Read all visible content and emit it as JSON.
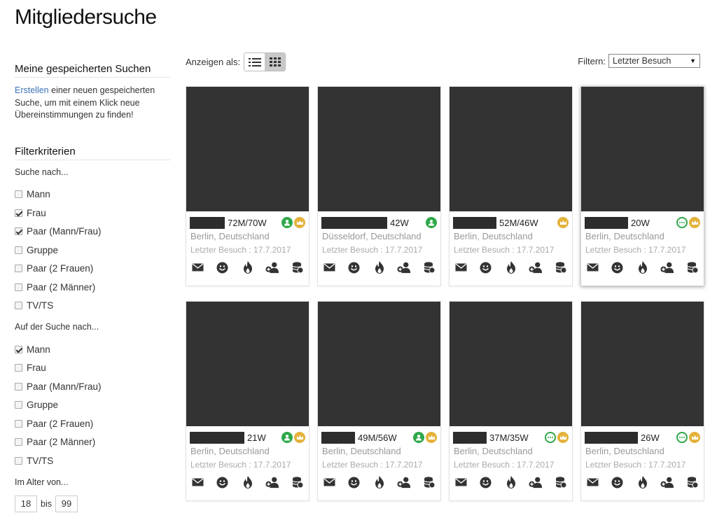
{
  "page_title": "Mitgliedersuche",
  "sidebar": {
    "saved": {
      "heading": "Meine gespeicherten Suchen",
      "link": "Erstellen",
      "text": " einer neuen gespeicherten Suche, um mit einem Klick neue Übereinstimmungen zu finden!"
    },
    "filters": {
      "heading": "Filterkriterien",
      "search_for_label": "Suche nach...",
      "search_for": [
        {
          "label": "Mann",
          "checked": false
        },
        {
          "label": "Frau",
          "checked": true
        },
        {
          "label": "Paar (Mann/Frau)",
          "checked": true
        },
        {
          "label": "Gruppe",
          "checked": false
        },
        {
          "label": "Paar (2 Frauen)",
          "checked": false
        },
        {
          "label": "Paar (2 Männer)",
          "checked": false
        },
        {
          "label": "TV/TS",
          "checked": false
        }
      ],
      "looking_for_label": "Auf der Suche nach...",
      "looking_for": [
        {
          "label": "Mann",
          "checked": true
        },
        {
          "label": "Frau",
          "checked": false
        },
        {
          "label": "Paar (Mann/Frau)",
          "checked": false
        },
        {
          "label": "Gruppe",
          "checked": false
        },
        {
          "label": "Paar (2 Frauen)",
          "checked": false
        },
        {
          "label": "Paar (2 Männer)",
          "checked": false
        },
        {
          "label": "TV/TS",
          "checked": false
        }
      ],
      "age_label": "Im Alter von...",
      "age_from": "18",
      "age_sep": "bis",
      "age_to": "99"
    }
  },
  "toolbar": {
    "view_label": "Anzeigen als:",
    "filter_label": "Filtern:",
    "filter_value": "Letzter Besuch"
  },
  "cards": [
    {
      "ages": "72M/70W",
      "city": "Berlin, Deutschland",
      "visit": "Letzter Besuch : 17.7.2017",
      "badges": [
        "person-icon",
        "crown-icon"
      ]
    },
    {
      "ages": "42W",
      "city": "Düsseldorf, Deutschland",
      "visit": "Letzter Besuch : 17.7.2017",
      "badges": [
        "person-icon"
      ]
    },
    {
      "ages": "52M/46W",
      "city": "Berlin, Deutschland",
      "visit": "Letzter Besuch : 17.7.2017",
      "badges": [
        "crown-icon"
      ]
    },
    {
      "ages": "20W",
      "city": "Berlin, Deutschland",
      "visit": "Letzter Besuch : 17.7.2017",
      "badges": [
        "chat-icon",
        "crown-icon"
      ]
    },
    {
      "ages": "21W",
      "city": "Berlin, Deutschland",
      "visit": "Letzter Besuch : 17.7.2017",
      "badges": [
        "person-icon",
        "crown-icon"
      ]
    },
    {
      "ages": "49M/56W",
      "city": "Berlin, Deutschland",
      "visit": "Letzter Besuch : 17.7.2017",
      "badges": [
        "person-icon",
        "crown-icon"
      ]
    },
    {
      "ages": "37M/35W",
      "city": "Berlin, Deutschland",
      "visit": "Letzter Besuch : 17.7.2017",
      "badges": [
        "chat-icon",
        "crown-icon"
      ]
    },
    {
      "ages": "26W",
      "city": "Berlin, Deutschland",
      "visit": "Letzter Besuch : 17.7.2017",
      "badges": [
        "chat-icon",
        "crown-icon"
      ]
    }
  ],
  "card_actions": [
    "mail-icon",
    "smile-icon",
    "flame-icon",
    "add-friend-icon",
    "coins-icon"
  ],
  "colors": {
    "link": "#3a72b8",
    "green": "#2fa84a",
    "gold": "#e4b23b",
    "photo": "#333333"
  }
}
